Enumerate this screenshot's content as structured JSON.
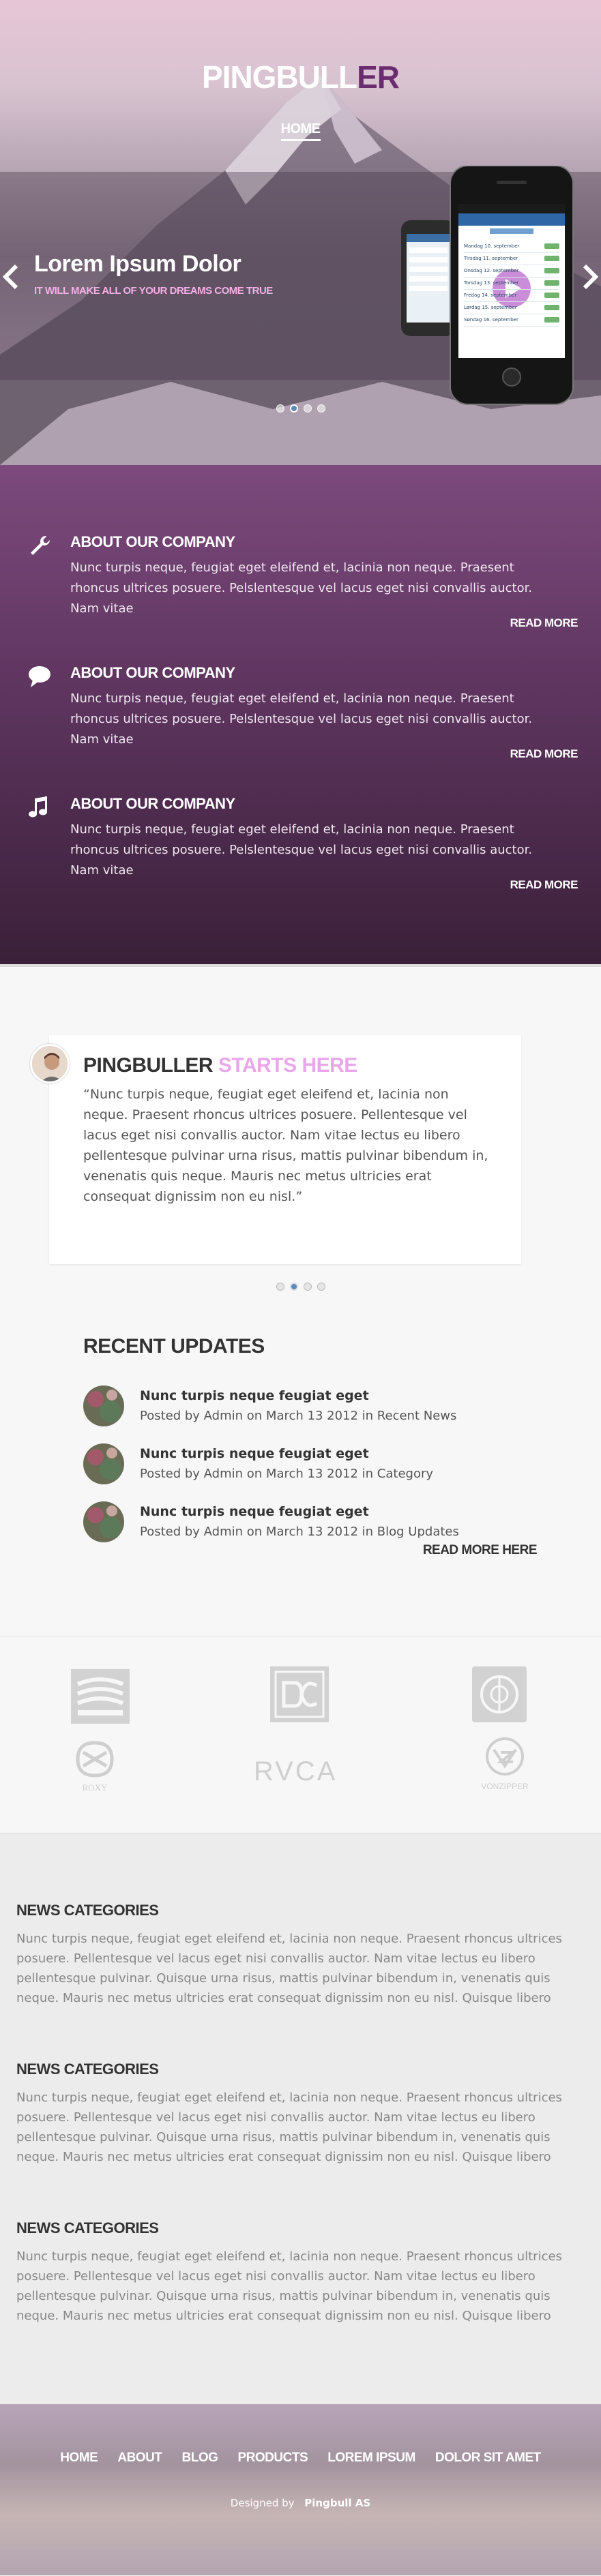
{
  "header": {
    "logo_main": "PINGBULL",
    "logo_accent": "ER",
    "nav_home": "HOME"
  },
  "slider": {
    "title": "Lorem Ipsum Dolor",
    "subtitle": "IT WILL MAKE ALL OF YOUR DREAMS COME TRUE",
    "active_dot": 2,
    "dot_count": 4,
    "phone_rows": [
      "Mandag 10. september",
      "Tirsdag 11. september",
      "Onsdag 12. september",
      "Torsdag 13. september",
      "Fredag 14. september",
      "Lørdag 15. september",
      "Søndag 16. september"
    ]
  },
  "features": [
    {
      "icon": "wrench-icon",
      "title": "ABOUT OUR COMPANY",
      "text": "Nunc turpis neque, feugiat eget eleifend et, lacinia non neque. Praesent rhoncus ultrices posuere. Pelslentesque vel lacus eget nisi convallis auctor. Nam vitae",
      "more": "READ MORE"
    },
    {
      "icon": "chat-bubble-icon",
      "title": "ABOUT OUR COMPANY",
      "text": "Nunc turpis neque, feugiat eget eleifend et, lacinia non neque. Praesent rhoncus ultrices posuere. Pelslentesque vel lacus eget nisi convallis auctor. Nam vitae",
      "more": "READ MORE"
    },
    {
      "icon": "music-note-icon",
      "title": "ABOUT OUR COMPANY",
      "text": "Nunc turpis neque, feugiat eget eleifend et, lacinia non neque. Praesent rhoncus ultrices posuere. Pelslentesque vel lacus eget nisi convallis auctor. Nam vitae",
      "more": "READ MORE"
    }
  ],
  "testimonial": {
    "title_main": "PINGBULLER",
    "title_accent": "STARTS HERE",
    "quote": "“Nunc turpis neque, feugiat eget eleifend et, lacinia non neque. Praesent rhoncus ultrices posuere. Pellentesque vel lacus eget nisi convallis auctor. Nam vitae lectus eu libero pellentesque pulvinar urna risus, mattis pulvinar bibendum in, venenatis quis neque. Mauris nec metus ultricies erat consequat dignissim non eu nisl.”",
    "active_dot": 2
  },
  "updates": {
    "title": "RECENT UPDATES",
    "items": [
      {
        "title": "Nunc turpis neque feugiat eget",
        "meta": "Posted by Admin on March 13 2012 in Recent News"
      },
      {
        "title": "Nunc turpis neque feugiat eget",
        "meta": "Posted by Admin on March 13 2012 in Category"
      },
      {
        "title": "Nunc turpis neque feugiat eget",
        "meta": "Posted by Admin on March 13 2012 in Blog Updates"
      }
    ],
    "more": "READ MORE HERE"
  },
  "brands": {
    "rvca": "RVCA",
    "vonzipper": "VONZIPPER",
    "roxy": "ROXY"
  },
  "news": [
    {
      "title": "NEWS CATEGORIES",
      "text": "Nunc turpis neque, feugiat eget eleifend et, lacinia non neque. Praesent rhoncus ultrices posuere. Pellentesque vel lacus eget nisi convallis auctor. Nam vitae lectus eu libero pellentesque pulvinar. Quisque urna risus, mattis pulvinar bibendum in, venenatis quis neque. Mauris nec metus ultricies erat consequat dignissim non eu nisl. Quisque libero"
    },
    {
      "title": "NEWS CATEGORIES",
      "text": "Nunc turpis neque, feugiat eget eleifend et, lacinia non neque. Praesent rhoncus ultrices posuere. Pellentesque vel lacus eget nisi convallis auctor. Nam vitae lectus eu libero pellentesque pulvinar. Quisque urna risus, mattis pulvinar bibendum in, venenatis quis neque. Mauris nec metus ultricies erat consequat dignissim non eu nisl. Quisque libero"
    },
    {
      "title": "NEWS CATEGORIES",
      "text": "Nunc turpis neque, feugiat eget eleifend et, lacinia non neque. Praesent rhoncus ultrices posuere. Pellentesque vel lacus eget nisi convallis auctor. Nam vitae lectus eu libero pellentesque pulvinar. Quisque urna risus, mattis pulvinar bibendum in, venenatis quis neque. Mauris nec metus ultricies erat consequat dignissim non eu nisl. Quisque libero"
    }
  ],
  "footer": {
    "nav": [
      "HOME",
      "ABOUT",
      "BLOG",
      "PRODUCTS",
      "LOREM IPSUM",
      "DOLOR SIT AMET"
    ],
    "designed_by": "Designed by",
    "designer": "Pingbull AS"
  },
  "colors": {
    "accent_purple": "#6a2c6f",
    "accent_pink": "#e9a6ea",
    "slide_subtitle": "#f5b0e8",
    "dot_active": "#5a8bbd"
  }
}
